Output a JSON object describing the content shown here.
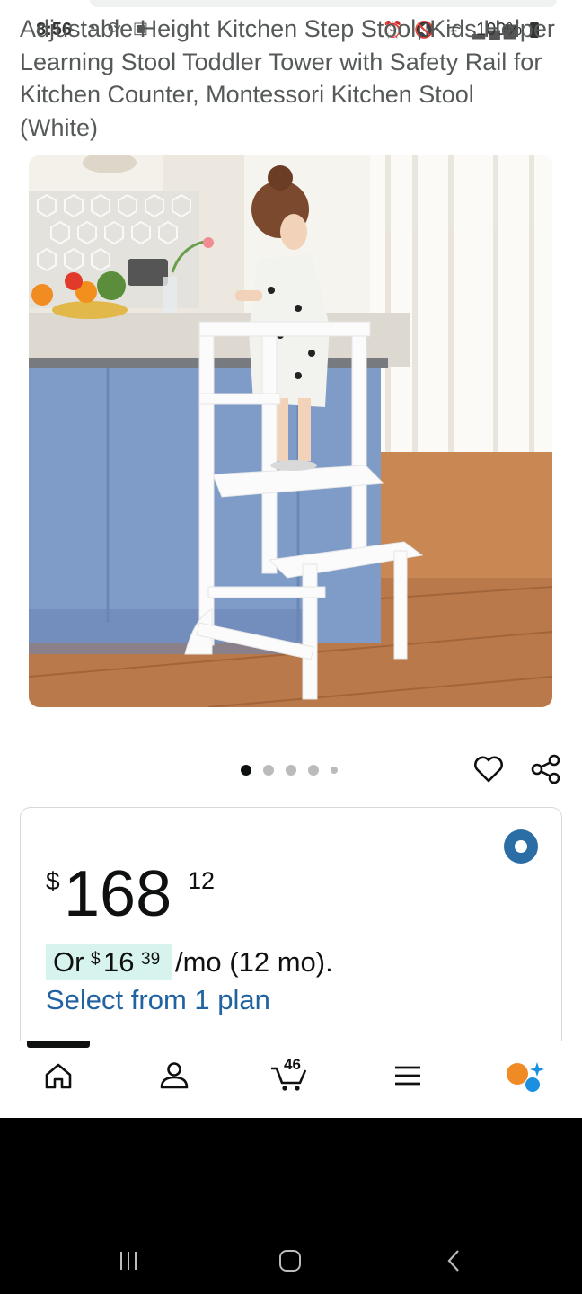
{
  "status_bar": {
    "time": "8:56",
    "battery": "100%",
    "left_icons": [
      "notification-icon",
      "sync-icon",
      "gallery-icon"
    ],
    "right_icons": [
      "alarm-icon",
      "mute-icon",
      "wifi-icon",
      "signal-icon",
      "battery-icon"
    ]
  },
  "product": {
    "title": "Adjustable Height Kitchen Step Stool, Kids Helper Learning Stool Toddler Tower with Safety Rail for Kitchen Counter, Montessori Kitchen Stool (White)"
  },
  "gallery": {
    "image_count": 5,
    "active_index": 0
  },
  "price": {
    "currency": "$",
    "whole": "168",
    "fraction": "12"
  },
  "monthly": {
    "or_label": "Or",
    "currency": "$",
    "whole": "16",
    "fraction": "39",
    "suffix": "/mo (12 mo)."
  },
  "plan_link": "Select from 1 plan",
  "nav": {
    "cart_count": "46",
    "items": [
      "home-icon",
      "account-icon",
      "cart-icon",
      "menu-icon",
      "rufus-ai-icon"
    ]
  },
  "colors": {
    "link": "#2162a1",
    "radio": "#2b6ea6",
    "highlight": "#d6f3ee",
    "ai_orange": "#f08a24",
    "ai_blue": "#1b8fe0"
  }
}
